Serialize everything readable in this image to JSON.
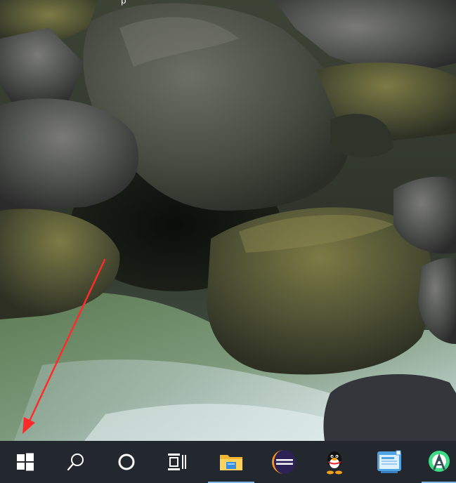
{
  "desktop": {
    "top_text": "p"
  },
  "taskbar": {
    "items": [
      {
        "name": "start-button",
        "icon": "windows-logo-icon",
        "running": false
      },
      {
        "name": "search-button",
        "icon": "search-icon",
        "running": false
      },
      {
        "name": "cortana-button",
        "icon": "cortana-ring-icon",
        "running": false
      },
      {
        "name": "task-view-button",
        "icon": "task-view-icon",
        "running": false
      },
      {
        "name": "file-explorer-button",
        "icon": "folder-icon",
        "running": true
      },
      {
        "name": "eclipse-button",
        "icon": "eclipse-icon",
        "running": false
      },
      {
        "name": "qq-button",
        "icon": "qq-penguin-icon",
        "running": false
      },
      {
        "name": "app-window-button",
        "icon": "app-window-icon",
        "running": false
      },
      {
        "name": "android-studio-button",
        "icon": "android-studio-icon",
        "running": true
      }
    ]
  },
  "colors": {
    "taskbar_bg": "#23272e",
    "taskbar_icon": "#ffffff",
    "running_indicator": "#7fb6e8",
    "arrow": "#ff2a2a"
  }
}
